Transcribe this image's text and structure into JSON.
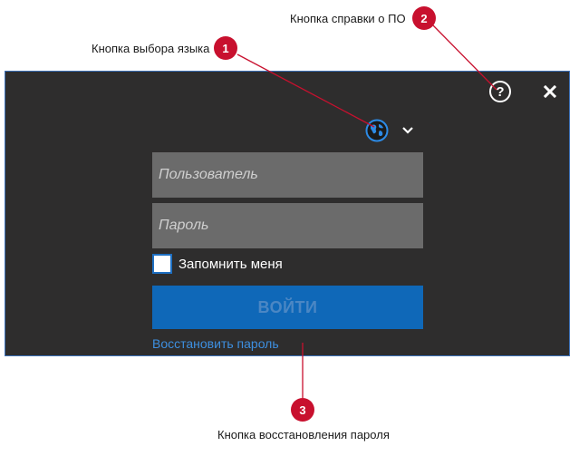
{
  "window": {
    "help_label": "?",
    "close_icon": "close-icon",
    "globe_icon": "globe-icon"
  },
  "form": {
    "username_placeholder": "Пользователь",
    "password_placeholder": "Пароль",
    "remember_label": "Запомнить меня",
    "remember_checked": false,
    "login_label": "ВОЙТИ",
    "restore_link": "Восстановить пароль"
  },
  "annotations": [
    {
      "number": "1",
      "text": "Кнопка выбора языка"
    },
    {
      "number": "2",
      "text": "Кнопка справки о ПО"
    },
    {
      "number": "3",
      "text": "Кнопка восстановления пароля"
    }
  ],
  "colors": {
    "window_bg": "#2e2d2d",
    "field_bg": "#6b6b6b",
    "accent": "#0f68b8",
    "link": "#3d8fe0",
    "marker": "#c8102e"
  }
}
